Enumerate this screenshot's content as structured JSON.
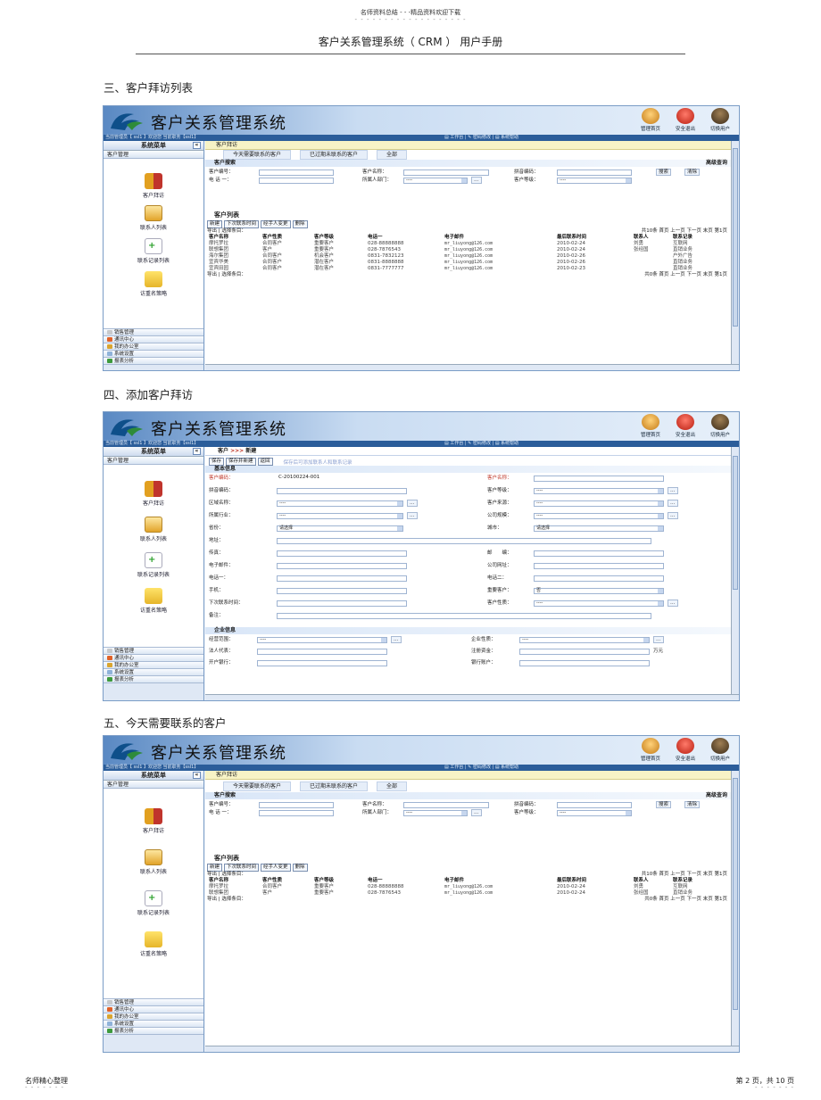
{
  "header": {
    "top_note": "名师资料总结 - - -精品资料欢迎下载",
    "dots": "- - - - - - - - - - - - - - - - - - -",
    "doc_title": "客户关系管理系统（    CRM  ）  用户手册"
  },
  "sections": [
    {
      "heading": "三、客户拜访列表"
    },
    {
      "heading": "四、添加客户拜访"
    },
    {
      "heading": "五、今天需要联系的客户"
    }
  ],
  "app": {
    "title": "客户关系管理系统",
    "toolbar": {
      "home": "管理首页",
      "exit": "安全退出",
      "switch": "切换用户"
    },
    "status_left": "当前管理员【 ssl1 】欢迎您   当前职务【ssl1】",
    "status_right": "▤ 工作台  |  ✎ 密码修改  |  ▤ 系统帮助",
    "sidebar": {
      "title": "系统菜单",
      "collapse": "«",
      "category": "客户管理",
      "items": [
        "客户拜访",
        "联系人列表",
        "联系记录列表",
        "访重名策略"
      ],
      "bottom": [
        "销售管理",
        "通讯中心",
        "我的办公室",
        "系统设置",
        "报表分析"
      ],
      "colors": [
        "#c7c9cc",
        "#e0622a",
        "#d9a530",
        "#8fb2d9",
        "#3d9a3d"
      ]
    }
  },
  "visit_list": {
    "tab": "客户拜访",
    "subtabs": [
      "今天需要联系的客户",
      "已过期未联系的客户",
      "全部"
    ],
    "search_title": "客户搜索",
    "advanced": "高级查询",
    "labels": {
      "code": "客户编号：",
      "name": "客户名称：",
      "pinyin": "拼音编码：",
      "phone": "电 话 一：",
      "dept": "所属人部门：",
      "level": "客户等级："
    },
    "select_default": "----",
    "more_btn": "…",
    "btn_search": "搜索",
    "btn_clear": "清除",
    "list_title": "客户列表",
    "tools": [
      "新建",
      "下次联系时间",
      "经手人变更",
      "删除"
    ],
    "export": "导出 | 选择条目：",
    "pager": "共10条  首页  上一页  下一页  末页",
    "pager_bottom": "共0条  首页  上一页  下一页  末页",
    "page_sel": "第1页",
    "columns": [
      "客户名称",
      "客户性质",
      "客户等级",
      "电话一",
      "电子邮件",
      "最后联系时间",
      "联系人",
      "联系记录"
    ],
    "rows": [
      [
        "摩托罗拉",
        "合同客户",
        "重要客户",
        "028-88888888",
        "mr_liuyong@126.com",
        "2010-02-24",
        "刘勇",
        "互联网"
      ],
      [
        "联想集团",
        "客户",
        "重要客户",
        "028-7876543",
        "mr_liuyong@126.com",
        "2010-02-24",
        "张经国",
        "直销业务"
      ],
      [
        "海尔集团",
        "合同客户",
        "机会客户",
        "0831-7832123",
        "mr_liuyong@126.com",
        "2010-02-26",
        "",
        "户外广告"
      ],
      [
        "宜宾华美",
        "合同客户",
        "潜在客户",
        "0831-8888888",
        "mr_liuyong@126.com",
        "2010-02-26",
        "",
        "直销业务"
      ],
      [
        "宜宾田园",
        "合同客户",
        "潜在客户",
        "0831-7777777",
        "mr_liuyong@126.com",
        "2010-02-23",
        "",
        "直销业务"
      ]
    ]
  },
  "add_visit": {
    "crumb": "客户",
    "crumb_arrow": ">>>",
    "crumb_page": "新建",
    "tools": [
      "保存",
      "保存并新建",
      "返回"
    ],
    "hint": "保存后可添加联系人和联系记录",
    "basic_title": "基本信息",
    "enterprise_title": "企业信息",
    "left_labels": [
      "客户编码：",
      "拼音编码：",
      "区域名称：",
      "所属行业：",
      "省份：",
      "地址：",
      "传真：",
      "电子邮件：",
      "电话一：",
      "手机：",
      "下次联系时间：",
      "备注："
    ],
    "right_labels": [
      "客户名称：",
      "客户等级：",
      "客户来源：",
      "公司规模：",
      "城市：",
      "",
      "邮　　编：",
      "公司网址：",
      "电话二：",
      "重要客户：",
      "客户性质：",
      ""
    ],
    "code_value": "C-20100224-001",
    "select_default": "----",
    "province_value": "请选择",
    "city_value": "请选择",
    "important_value": "否",
    "ent_left": [
      "经营范围：",
      "法人代表：",
      "开户银行："
    ],
    "ent_right": [
      "企业性质：",
      "注册资金：",
      "银行账户："
    ],
    "unit": "万元"
  }
}
